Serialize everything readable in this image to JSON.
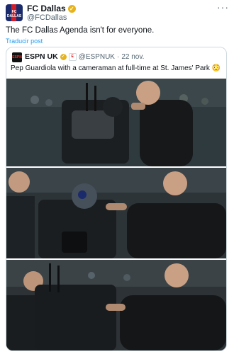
{
  "tweet": {
    "author_name": "FC Dallas",
    "author_handle": "@FCDallas",
    "avatar_text": "FC DALLAS",
    "more_label": "···",
    "text": "The FC Dallas Agenda isn't for everyone.",
    "translate_label": "Traducir post"
  },
  "quoted": {
    "logo_text": "ESPN",
    "author_name": "ESPN UK",
    "handle": "@ESPNUK",
    "separator": "·",
    "date": "22 nov.",
    "text": "Pep Guardiola with a cameraman at full-time at St. James' Park 😳",
    "photos": [
      {
        "alt": "Guardiola leaning toward cameraman's camera"
      },
      {
        "alt": "Guardiola holding cameraman's cap"
      },
      {
        "alt": "Guardiola speaking to cameraman"
      }
    ]
  },
  "colors": {
    "text": "#0f1419",
    "secondary": "#536471",
    "link": "#1d9bf0",
    "verified": "#e8b21b",
    "border": "#cfd9de"
  },
  "icons": [
    "verified-badge-icon",
    "more-icon",
    "espn-logo-icon",
    "affiliate-badge-icon"
  ]
}
